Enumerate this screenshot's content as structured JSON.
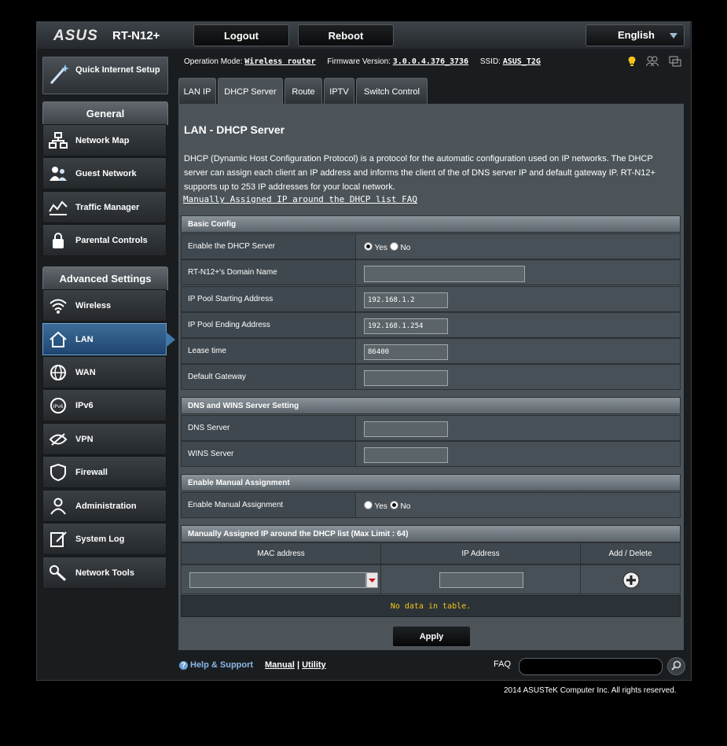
{
  "brand": {
    "logo": "ASUS",
    "model": "RT-N12+"
  },
  "top_buttons": {
    "logout": "Logout",
    "reboot": "Reboot"
  },
  "language": {
    "selected": "English"
  },
  "sidebar": {
    "quick_setup": "Quick Internet Setup",
    "general_header": "General",
    "general_items": [
      {
        "label": "Network Map",
        "icon": "network-map-icon"
      },
      {
        "label": "Guest Network",
        "icon": "guest-network-icon"
      },
      {
        "label": "Traffic Manager",
        "icon": "traffic-manager-icon"
      },
      {
        "label": "Parental Controls",
        "icon": "parental-controls-icon"
      }
    ],
    "advanced_header": "Advanced Settings",
    "advanced_items": [
      {
        "label": "Wireless",
        "icon": "wireless-icon"
      },
      {
        "label": "LAN",
        "icon": "lan-home-icon",
        "active": true
      },
      {
        "label": "WAN",
        "icon": "wan-globe-icon"
      },
      {
        "label": "IPv6",
        "icon": "ipv6-icon"
      },
      {
        "label": "VPN",
        "icon": "vpn-icon"
      },
      {
        "label": "Firewall",
        "icon": "firewall-shield-icon"
      },
      {
        "label": "Administration",
        "icon": "administration-icon"
      },
      {
        "label": "System Log",
        "icon": "system-log-icon"
      },
      {
        "label": "Network Tools",
        "icon": "network-tools-icon"
      }
    ]
  },
  "status": {
    "op_mode_label": "Operation Mode:",
    "op_mode": "Wireless router",
    "firmware_label": "Firmware Version:",
    "firmware": "3.0.0.4.376_3736",
    "ssid_label": "SSID:",
    "ssid": "ASUS_T2G"
  },
  "tabs": [
    "LAN IP",
    "DHCP Server",
    "Route",
    "IPTV",
    "Switch Control"
  ],
  "active_tab": "DHCP Server",
  "page": {
    "title": "LAN - DHCP Server",
    "description": "DHCP (Dynamic Host Configuration Protocol) is a protocol for the automatic configuration used on IP networks. The DHCP server can assign each client an IP address and informs the client of the of DNS server IP and default gateway IP. RT-N12+ supports up to 253 IP addresses for your local network.",
    "faq_link": "Manually Assigned IP around the DHCP list FAQ"
  },
  "basic_config": {
    "header": "Basic Config",
    "enable_label": "Enable the DHCP Server",
    "yes": "Yes",
    "no": "No",
    "enable_value": "Yes",
    "domain_label": "RT-N12+'s Domain Name",
    "domain_value": "",
    "start_label": "IP Pool Starting Address",
    "start_value": "192.168.1.2",
    "end_label": "IP Pool Ending Address",
    "end_value": "192.168.1.254",
    "lease_label": "Lease time",
    "lease_value": "86400",
    "gateway_label": "Default Gateway",
    "gateway_value": ""
  },
  "dns_wins": {
    "header": "DNS and WINS Server Setting",
    "dns_label": "DNS Server",
    "dns_value": "",
    "wins_label": "WINS Server",
    "wins_value": ""
  },
  "manual": {
    "header": "Enable Manual Assignment",
    "label": "Enable Manual Assignment",
    "yes": "Yes",
    "no": "No",
    "value": "No"
  },
  "manual_list": {
    "header": "Manually Assigned IP around the DHCP list (Max Limit : 64)",
    "col_mac": "MAC address",
    "col_ip": "IP Address",
    "col_action": "Add / Delete",
    "empty": "No data in table."
  },
  "apply": "Apply",
  "footer": {
    "help": "Help & Support",
    "manual": "Manual",
    "separator": "|",
    "utility": "Utility",
    "faq": "FAQ",
    "copyright": "2014 ASUSTeK Computer Inc. All rights reserved."
  }
}
